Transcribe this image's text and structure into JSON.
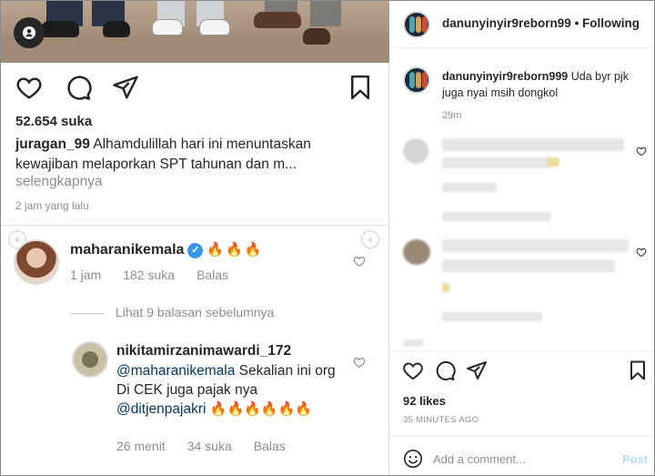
{
  "left_post": {
    "likes": "52.654 suka",
    "caption_user": "juragan_99",
    "caption_text": "Alhamdulillah hari ini menuntaskan kewajiban melaporkan SPT tahunan dan m...",
    "more_label": "selengkapnya",
    "time": "2 jam yang lalu",
    "comment1": {
      "username": "maharanikemala",
      "emoji": "🔥🔥🔥",
      "time": "1 jam",
      "likes": "182 suka",
      "reply": "Balas"
    },
    "view_replies": "Lihat 9 balasan sebelumnya",
    "comment2": {
      "username": "nikitamirzanimawardi_172",
      "mention1": "@maharanikemala",
      "text": "Sekalian ini org Di CEK juga pajak nya",
      "mention2": "@ditjenpajakri",
      "emoji": "🔥🔥🔥🔥🔥🔥",
      "time": "26 menit",
      "likes": "34 suka",
      "reply": "Balas"
    }
  },
  "right_post": {
    "username": "danunyinyir9reborn99",
    "separator": "•",
    "follow_label": "Following",
    "comment_user": "danunyinyir9reborn999",
    "comment_text": "Uda byr pjk juga nyai msih dongkol",
    "comment_time": "29m",
    "likes": "92 likes",
    "time": "35 MINUTES AGO",
    "add_comment_placeholder": "Add a comment...",
    "post_label": "Post"
  },
  "icons": [
    "account-icon",
    "heart-icon",
    "comment-icon",
    "share-icon",
    "bookmark-icon",
    "verified-icon",
    "emoji-icon",
    "chevron-left-icon",
    "chevron-right-icon"
  ],
  "colors": {
    "link": "#00376b",
    "verified": "#3897f0",
    "post_disabled": "#b2dffc",
    "muted": "#8e8e8e"
  }
}
